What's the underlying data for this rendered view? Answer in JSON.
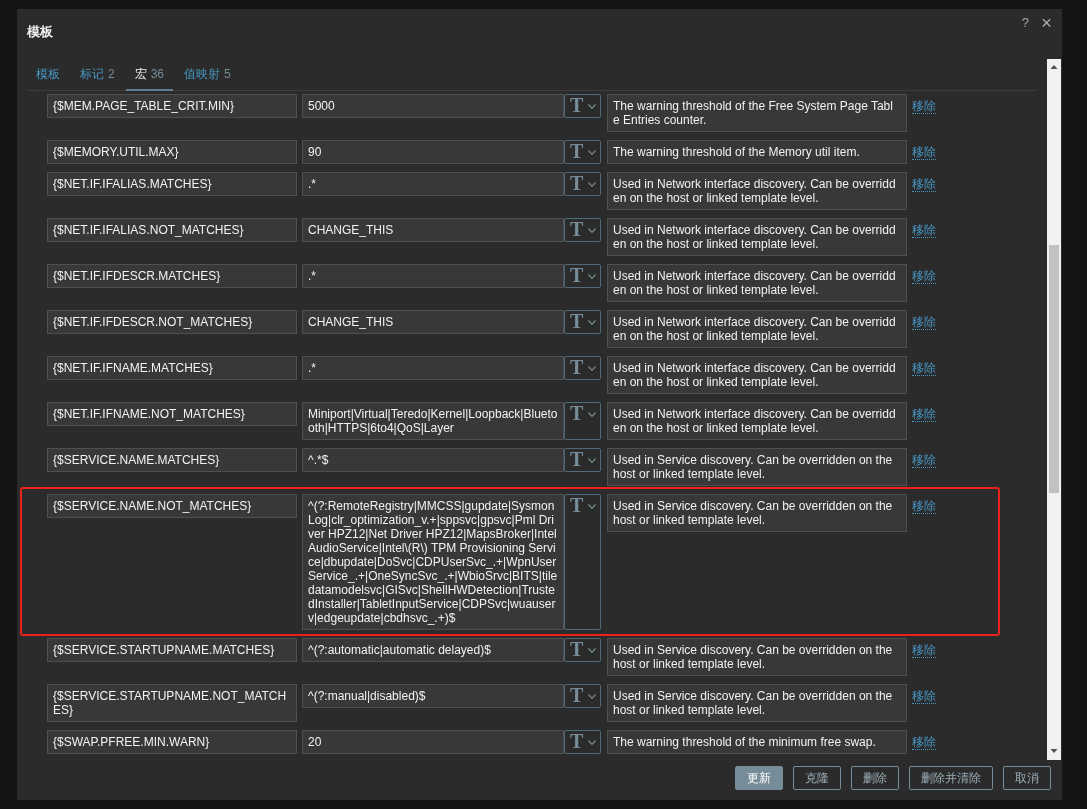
{
  "dialog": {
    "title": "模板",
    "help": "?",
    "close": "×"
  },
  "tabs": [
    {
      "label": "模板",
      "selected": false
    },
    {
      "label": "标记",
      "count": "2",
      "selected": false
    },
    {
      "label": "宏",
      "count": "36",
      "selected": true
    },
    {
      "label": "值映射",
      "count": "5",
      "selected": false
    }
  ],
  "macros": [
    {
      "macro": "{$MEM.PAGE_TABLE_CRIT.MIN}",
      "value": "5000",
      "type_button": "T",
      "description": "The warning threshold of the Free System Page Table Entries counter.",
      "action": "移除",
      "highlighted": false
    },
    {
      "macro": "{$MEMORY.UTIL.MAX}",
      "value": "90",
      "type_button": "T",
      "description": "The warning threshold of the Memory util item.",
      "action": "移除",
      "highlighted": false
    },
    {
      "macro": "{$NET.IF.IFALIAS.MATCHES}",
      "value": ".*",
      "type_button": "T",
      "description": "Used in Network interface discovery. Can be overridden on the host or linked template level.",
      "action": "移除",
      "highlighted": false
    },
    {
      "macro": "{$NET.IF.IFALIAS.NOT_MATCHES}",
      "value": "CHANGE_THIS",
      "type_button": "T",
      "description": "Used in Network interface discovery. Can be overridden on the host or linked template level.",
      "action": "移除",
      "highlighted": false
    },
    {
      "macro": "{$NET.IF.IFDESCR.MATCHES}",
      "value": ".*",
      "type_button": "T",
      "description": "Used in Network interface discovery. Can be overridden on the host or linked template level.",
      "action": "移除",
      "highlighted": false
    },
    {
      "macro": "{$NET.IF.IFDESCR.NOT_MATCHES}",
      "value": "CHANGE_THIS",
      "type_button": "T",
      "description": "Used in Network interface discovery. Can be overridden on the host or linked template level.",
      "action": "移除",
      "highlighted": false
    },
    {
      "macro": "{$NET.IF.IFNAME.MATCHES}",
      "value": ".*",
      "type_button": "T",
      "description": "Used in Network interface discovery. Can be overridden on the host or linked template level.",
      "action": "移除",
      "highlighted": false
    },
    {
      "macro": "{$NET.IF.IFNAME.NOT_MATCHES}",
      "value": "Miniport|Virtual|Teredo|Kernel|Loopback|Bluetooth|HTTPS|6to4|QoS|Layer",
      "type_button": "T",
      "description": "Used in Network interface discovery. Can be overridden on the host or linked template level.",
      "action": "移除",
      "highlighted": false
    },
    {
      "macro": "{$SERVICE.NAME.MATCHES}",
      "value": "^.*$",
      "type_button": "T",
      "description": "Used in Service discovery. Can be overridden on the host or linked template level.",
      "action": "移除",
      "highlighted": false
    },
    {
      "macro": "{$SERVICE.NAME.NOT_MATCHES}",
      "value": "^(?:RemoteRegistry|MMCSS|gupdate|SysmonLog|clr_optimization_v.+|sppsvc|gpsvc|Pml Driver HPZ12|Net Driver HPZ12|MapsBroker|IntelAudioService|Intel\\(R\\) TPM Provisioning Service|dbupdate|DoSvc|CDPUserSvc_.+|WpnUserService_.+|OneSyncSvc_.+|WbioSrvc|BITS|tiledatamodelsvc|GISvc|ShellHWDetection|TrustedInstaller|TabletInputService|CDPSvc|wuauserv|edgeupdate|cbdhsvc_.+)$",
      "type_button": "T",
      "description": "Used in Service discovery. Can be overridden on the host or linked template level.",
      "action": "移除",
      "highlighted": true
    },
    {
      "macro": "{$SERVICE.STARTUPNAME.MATCHES}",
      "value": "^(?:automatic|automatic delayed)$",
      "type_button": "T",
      "description": "Used in Service discovery. Can be overridden on the host or linked template level.",
      "action": "移除",
      "highlighted": false
    },
    {
      "macro": "{$SERVICE.STARTUPNAME.NOT_MATCHES}",
      "value": "^(?:manual|disabled)$",
      "type_button": "T",
      "description": "Used in Service discovery. Can be overridden on the host or linked template level.",
      "action": "移除",
      "highlighted": false
    },
    {
      "macro": "{$SWAP.PFREE.MIN.WARN}",
      "value": "20",
      "type_button": "T",
      "description": "The warning threshold of the minimum free swap.",
      "action": "移除",
      "highlighted": false
    }
  ],
  "buttons": [
    {
      "label": "更新",
      "kind": "primary"
    },
    {
      "label": "克隆",
      "kind": "secondary"
    },
    {
      "label": "删除",
      "kind": "secondary"
    },
    {
      "label": "删除并清除",
      "kind": "secondary"
    },
    {
      "label": "取消",
      "kind": "secondary"
    }
  ]
}
